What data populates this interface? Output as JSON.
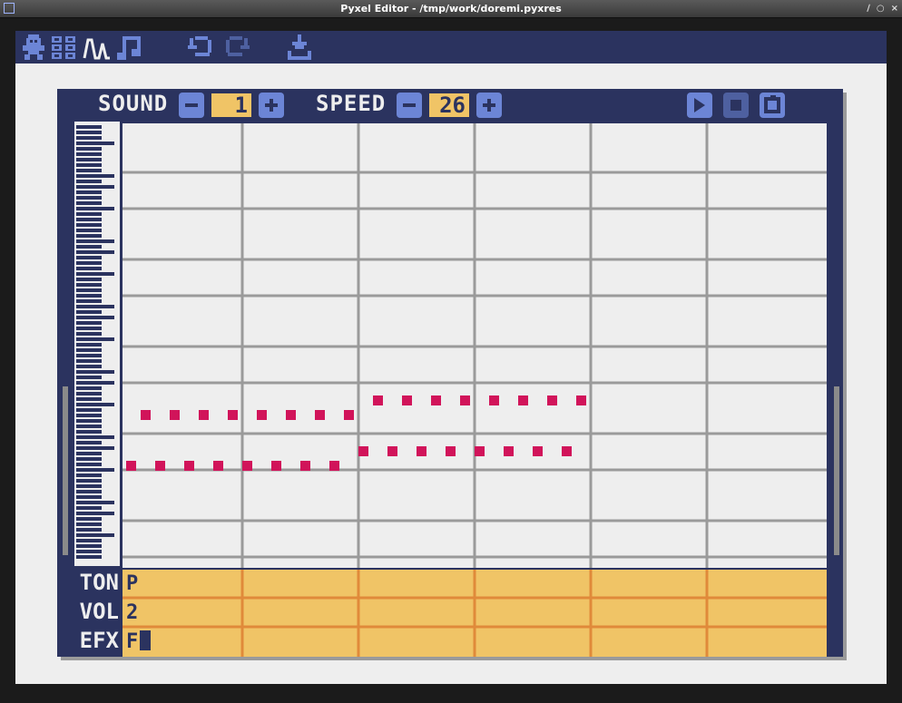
{
  "window": {
    "title": "Pyxel Editor - /tmp/work/doremi.pyxres",
    "controls": [
      "∕",
      "○",
      "×"
    ]
  },
  "menubar": {
    "tools": [
      {
        "name": "image-editor-icon"
      },
      {
        "name": "tilemap-editor-icon"
      },
      {
        "name": "sound-editor-icon"
      },
      {
        "name": "music-editor-icon"
      }
    ],
    "undo": "undo-icon",
    "redo": "redo-icon",
    "save": "download-icon"
  },
  "header": {
    "sound_label": "SOUND",
    "sound_value": "1",
    "speed_label": "SPEED",
    "speed_value": "26",
    "controls": [
      "play-icon",
      "stop-icon",
      "loop-icon"
    ]
  },
  "rows": {
    "tone": {
      "label": "TON",
      "value": "P"
    },
    "volume": {
      "label": "VOL",
      "value": "2"
    },
    "effect": {
      "label": "EFX",
      "value": "F"
    }
  },
  "colors": {
    "navy": "#2b335f",
    "accent_blue": "#6c85d6",
    "note_pink": "#d1145a",
    "field_yellow": "#f0c466",
    "field_line": "#e08a3a",
    "bg": "#eeeeee"
  }
}
